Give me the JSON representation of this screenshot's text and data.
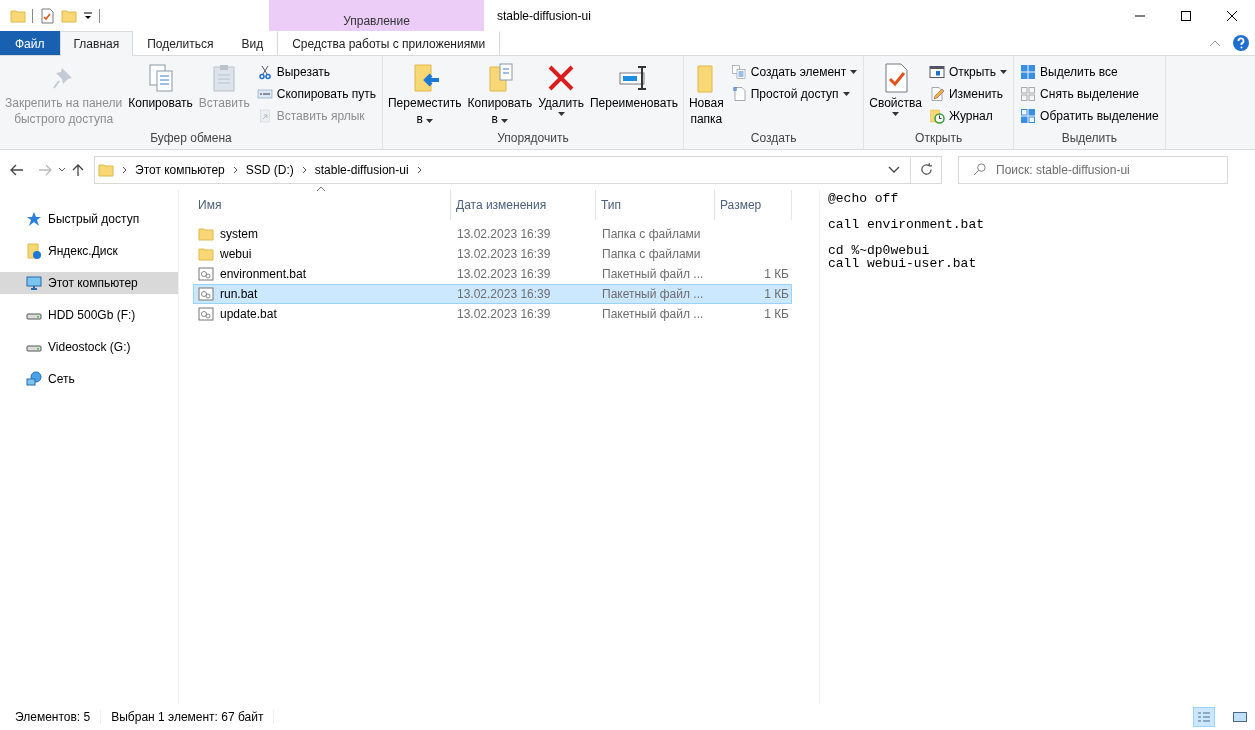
{
  "window": {
    "title": "stable-diffusion-ui",
    "context_header": "Управление"
  },
  "tabs": [
    {
      "label": "Файл",
      "kind": "file",
      "selected": false
    },
    {
      "label": "Главная",
      "kind": "normal",
      "selected": true
    },
    {
      "label": "Поделиться",
      "kind": "normal",
      "selected": false
    },
    {
      "label": "Вид",
      "kind": "normal",
      "selected": false
    },
    {
      "label": "Средства работы с приложениями",
      "kind": "context",
      "selected": false
    }
  ],
  "ribbon": [
    {
      "label": "Буфер обмена",
      "items": [
        {
          "kind": "large",
          "lines": [
            "Закрепить на панели",
            "быстрого доступа"
          ],
          "disabled": true,
          "dropdown": false
        },
        {
          "kind": "large",
          "lines": [
            "Копировать"
          ],
          "disabled": false,
          "dropdown": false
        },
        {
          "kind": "large",
          "lines": [
            "Вставить"
          ],
          "disabled": true,
          "dropdown": false
        },
        {
          "kind": "small",
          "lines": [
            "Вырезать"
          ],
          "disabled": false,
          "dropdown": false
        },
        {
          "kind": "small",
          "lines": [
            "Скопировать путь"
          ],
          "disabled": false,
          "dropdown": false
        },
        {
          "kind": "small",
          "lines": [
            "Вставить ярлык"
          ],
          "disabled": true,
          "dropdown": false
        }
      ]
    },
    {
      "label": "Упорядочить",
      "items": [
        {
          "kind": "large",
          "lines": [
            "Переместить",
            "в"
          ],
          "disabled": false,
          "dropdown": true
        },
        {
          "kind": "large",
          "lines": [
            "Копировать",
            "в"
          ],
          "disabled": false,
          "dropdown": true
        },
        {
          "kind": "large",
          "lines": [
            "Удалить"
          ],
          "disabled": false,
          "dropdown": true
        },
        {
          "kind": "large",
          "lines": [
            "Переименовать"
          ],
          "disabled": false,
          "dropdown": false
        }
      ]
    },
    {
      "label": "Создать",
      "items": [
        {
          "kind": "large",
          "lines": [
            "Новая",
            "папка"
          ],
          "disabled": false,
          "dropdown": false
        },
        {
          "kind": "small",
          "lines": [
            "Создать элемент"
          ],
          "disabled": false,
          "dropdown": true
        },
        {
          "kind": "small",
          "lines": [
            "Простой доступ"
          ],
          "disabled": false,
          "dropdown": true
        }
      ]
    },
    {
      "label": "Открыть",
      "items": [
        {
          "kind": "large",
          "lines": [
            "Свойства"
          ],
          "disabled": false,
          "dropdown": true
        },
        {
          "kind": "small",
          "lines": [
            "Открыть"
          ],
          "disabled": false,
          "dropdown": true
        },
        {
          "kind": "small",
          "lines": [
            "Изменить"
          ],
          "disabled": false,
          "dropdown": false
        },
        {
          "kind": "small",
          "lines": [
            "Журнал"
          ],
          "disabled": false,
          "dropdown": false
        }
      ]
    },
    {
      "label": "Выделить",
      "items": [
        {
          "kind": "small",
          "lines": [
            "Выделить все"
          ],
          "disabled": false,
          "dropdown": false
        },
        {
          "kind": "small",
          "lines": [
            "Снять выделение"
          ],
          "disabled": false,
          "dropdown": false
        },
        {
          "kind": "small",
          "lines": [
            "Обратить выделение"
          ],
          "disabled": false,
          "dropdown": false
        }
      ]
    }
  ],
  "address": {
    "path": [
      "Этот компьютер",
      "SSD (D:)",
      "stable-diffusion-ui"
    ],
    "search_placeholder": "Поиск: stable-diffusion-ui"
  },
  "sidebar": {
    "items": [
      {
        "label": "Быстрый доступ",
        "kind": "quick",
        "selected": false
      },
      {
        "label": "Яндекс.Диск",
        "kind": "cloud",
        "selected": false
      },
      {
        "label": "Этот компьютер",
        "kind": "pc",
        "selected": true
      },
      {
        "label": "HDD 500Gb (F:)",
        "kind": "drive",
        "selected": false
      },
      {
        "label": "Videostock (G:)",
        "kind": "drive",
        "selected": false
      },
      {
        "label": "Сеть",
        "kind": "network",
        "selected": false
      }
    ]
  },
  "table": {
    "columns": [
      "Имя",
      "Дата изменения",
      "Тип",
      "Размер"
    ],
    "rows": [
      {
        "kind": "folder",
        "name": "system",
        "date": "13.02.2023 16:39",
        "type": "Папка с файлами",
        "selected": false
      },
      {
        "kind": "folder",
        "name": "webui",
        "date": "13.02.2023 16:39",
        "type": "Папка с файлами",
        "selected": false
      },
      {
        "kind": "bat",
        "name": "environment.bat",
        "date": "13.02.2023 16:39",
        "type": "Пакетный файл ...",
        "size": "1 КБ",
        "selected": false
      },
      {
        "kind": "bat",
        "name": "run.bat",
        "date": "13.02.2023 16:39",
        "type": "Пакетный файл ...",
        "size": "1 КБ",
        "selected": true
      },
      {
        "kind": "bat",
        "name": "update.bat",
        "date": "13.02.2023 16:39",
        "type": "Пакетный файл ...",
        "size": "1 КБ",
        "selected": false
      }
    ]
  },
  "preview": {
    "text": "@echo off\n\ncall environment.bat\n\ncd %~dp0webui\ncall webui-user.bat"
  },
  "status_bar": {
    "count": "Элементов: 5",
    "selection": "Выбран 1 элемент: 67 байт",
    "views": [
      {
        "kind": "details",
        "selected": true
      },
      {
        "kind": "tiles",
        "selected": false
      }
    ]
  }
}
